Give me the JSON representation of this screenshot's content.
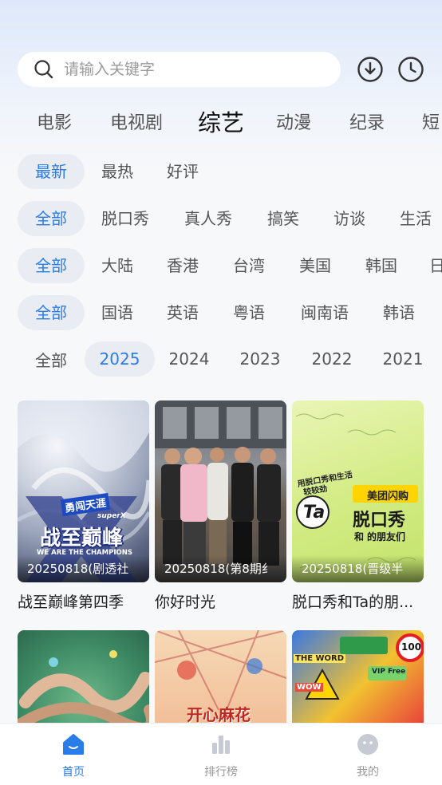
{
  "search": {
    "placeholder": "请输入关键字"
  },
  "header_icons": [
    "download-icon",
    "history-clock-icon"
  ],
  "category_tabs": [
    {
      "label": "电影"
    },
    {
      "label": "电视剧"
    },
    {
      "label": "综艺"
    },
    {
      "label": "动漫"
    },
    {
      "label": "纪录"
    },
    {
      "label": "短"
    }
  ],
  "category_active": "综艺",
  "filters": {
    "sort": [
      "最新",
      "最热",
      "好评"
    ],
    "type": [
      "全部",
      "脱口秀",
      "真人秀",
      "搞笑",
      "访谈",
      "生活"
    ],
    "region": [
      "全部",
      "大陆",
      "香港",
      "台湾",
      "美国",
      "韩国",
      "日"
    ],
    "lang": [
      "全部",
      "国语",
      "英语",
      "粤语",
      "闽南语",
      "韩语"
    ],
    "year": [
      "全部",
      "2025",
      "2024",
      "2023",
      "2022",
      "2021"
    ]
  },
  "selected": {
    "sort": "最新",
    "type": "全部",
    "region": "全部",
    "lang": "全部",
    "year": "2025"
  },
  "shows": [
    {
      "title": "战至巅峰第四季",
      "caption": "20250818(剧透社",
      "poster_text": [
        "勇闯天涯",
        "superX",
        "战至巅峰",
        "WE ARE THE CHAMPIONS"
      ]
    },
    {
      "title": "你好时光",
      "caption": "20250818(第8期纟",
      "poster_text": []
    },
    {
      "title": "脱口秀和Ta的朋...",
      "caption": "20250818(晋级半",
      "poster_text": [
        "用脱口秀和生活",
        "较较劲",
        "美团闪购",
        "脱口秀",
        "和",
        "Ta",
        "的朋友们"
      ]
    },
    {
      "title": "",
      "caption": "",
      "poster_text": []
    },
    {
      "title": "",
      "caption": "",
      "poster_text": [
        "开心麻花"
      ]
    },
    {
      "title": "",
      "caption": "",
      "poster_text": [
        "THE WORD",
        "VIP Free",
        "100",
        "WOW"
      ]
    }
  ],
  "bottom_nav": [
    {
      "label": "首页",
      "icon": "home-icon",
      "active": true
    },
    {
      "label": "排行榜",
      "icon": "ranking-bar-icon",
      "active": false
    },
    {
      "label": "我的",
      "icon": "profile-icon",
      "active": false
    }
  ],
  "colors": {
    "accent": "#2a7ce8",
    "chip_bg": "#e9ecf2",
    "page_bg": "#f7f8fa"
  }
}
